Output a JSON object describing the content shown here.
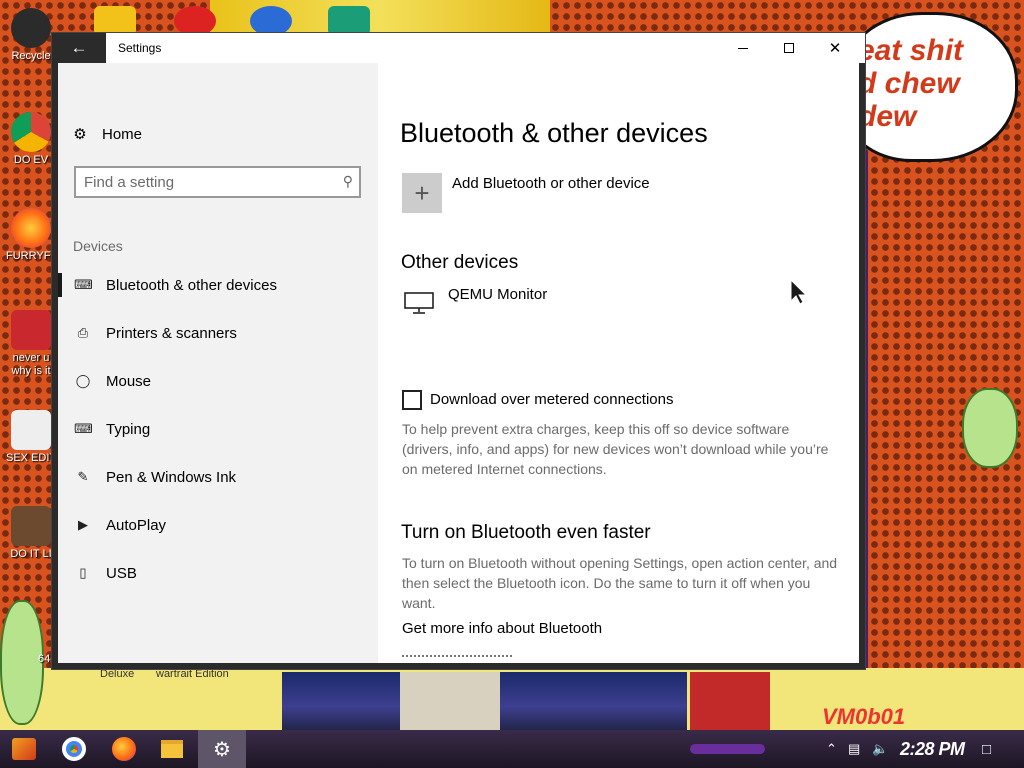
{
  "desktop": {
    "icons": [
      {
        "label": "Recycle"
      },
      {
        "label": "DO EV"
      },
      {
        "label": "FURRYFU"
      },
      {
        "label": "never u why is it"
      },
      {
        "label": "SEX EDIT"
      },
      {
        "label": "DO IT LI"
      },
      {
        "label": "64"
      }
    ],
    "bubble_lines": [
      "eat shit",
      "d chew",
      "dew"
    ],
    "bottom_labels": [
      "Deluxe",
      "wartrait Edition"
    ],
    "watermark": "VM0b01"
  },
  "window": {
    "title": "Settings",
    "back_icon": "back-arrow-icon",
    "controls": {
      "minimize": "minimize-icon",
      "maximize": "maximize-icon",
      "close": "close-icon"
    }
  },
  "sidebar": {
    "home_label": "Home",
    "search_placeholder": "Find a setting",
    "section_label": "Devices",
    "items": [
      {
        "label": "Bluetooth & other devices",
        "icon": "bluetooth-devices-icon",
        "selected": true
      },
      {
        "label": "Printers & scanners",
        "icon": "printer-icon"
      },
      {
        "label": "Mouse",
        "icon": "mouse-icon"
      },
      {
        "label": "Typing",
        "icon": "keyboard-icon"
      },
      {
        "label": "Pen & Windows Ink",
        "icon": "pen-icon"
      },
      {
        "label": "AutoPlay",
        "icon": "autoplay-icon"
      },
      {
        "label": "USB",
        "icon": "usb-icon"
      }
    ]
  },
  "main": {
    "title": "Bluetooth & other devices",
    "add_device_label": "Add Bluetooth or other device",
    "other_devices_heading": "Other devices",
    "device_name": "QEMU Monitor",
    "metered_checkbox_label": "Download over metered connections",
    "metered_checked": false,
    "metered_description": "To help prevent extra charges, keep this off so device software (drivers, info, and apps) for new devices won’t download while you’re on metered Internet connections.",
    "faster_heading": "Turn on Bluetooth even faster",
    "faster_description": "To turn on Bluetooth without opening Settings, open action center, and then select the Bluetooth icon. Do the same to turn it off when you want.",
    "more_info_link": "Get more info about Bluetooth"
  },
  "taskbar": {
    "apps": [
      "start-icon",
      "chrome-icon",
      "firefox-icon",
      "file-explorer-icon",
      "settings-icon"
    ],
    "clock": "2:28 PM"
  }
}
